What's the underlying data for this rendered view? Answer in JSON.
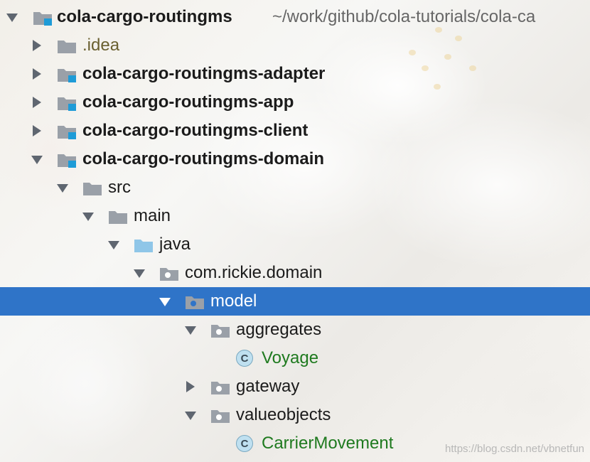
{
  "project": {
    "name": "cola-cargo-routingms",
    "path": "~/work/github/cola-tutorials/cola-ca"
  },
  "tree": {
    "idea": ".idea",
    "adapter": "cola-cargo-routingms-adapter",
    "app": "cola-cargo-routingms-app",
    "client": "cola-cargo-routingms-client",
    "domain": "cola-cargo-routingms-domain",
    "src": "src",
    "main": "main",
    "java": "java",
    "package": "com.rickie.domain",
    "model": "model",
    "aggregates": "aggregates",
    "voyage": "Voyage",
    "gateway": "gateway",
    "valueobjects": "valueobjects",
    "carrier": "CarrierMovement"
  },
  "icons": {
    "class_letter": "C"
  },
  "colors": {
    "selection": "#2f74c8",
    "module_badge": "#1e9bd7",
    "class_text": "#1f7a1f",
    "java_folder": "#8fc6e8",
    "folder": "#9aa0a8"
  },
  "watermark": "https://blog.csdn.net/vbnetfun"
}
